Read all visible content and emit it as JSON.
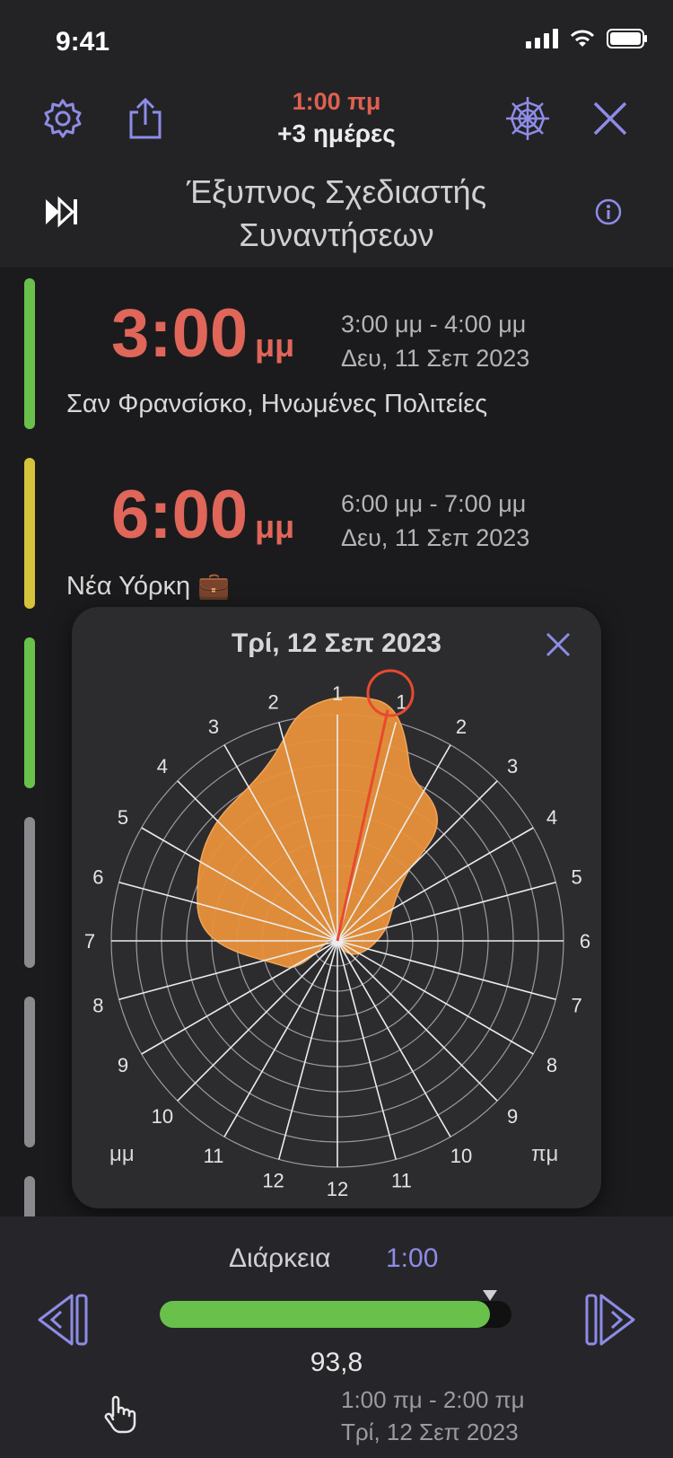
{
  "status": {
    "time": "9:41"
  },
  "header": {
    "time_label": "1:00 πμ",
    "offset_label": "+3 ημέρες",
    "title": "Έξυπνος Σχεδιαστής Συναντήσεων"
  },
  "events": [
    {
      "big_time": "3:00",
      "ampm": "μμ",
      "range": "3:00 μμ - 4:00 μμ",
      "date": "Δευ, 11 Σεπ 2023",
      "place": "Σαν Φρανσίσκο, Ηνωμένες Πολιτείες",
      "bar_color": "#69c14b"
    },
    {
      "big_time": "6:00",
      "ampm": "μμ",
      "range": "6:00 μμ - 7:00 μμ",
      "date": "Δευ, 11 Σεπ 2023",
      "place": "Νέα Υόρκη 💼",
      "bar_color": "#d7c23b"
    }
  ],
  "popup": {
    "title": "Τρί, 12 Σεπ 2023",
    "left_label": "μμ",
    "right_label": "πμ",
    "selected_hour": "1",
    "right_numbers": [
      "1",
      "2",
      "3",
      "4",
      "5",
      "6",
      "7",
      "8",
      "9",
      "10",
      "11",
      "12"
    ],
    "left_numbers": [
      "12",
      "11",
      "10",
      "9",
      "8",
      "7",
      "6",
      "5",
      "4",
      "3",
      "2",
      "1"
    ]
  },
  "footer": {
    "duration_label": "Διάρκεια",
    "duration_value": "1:00",
    "score": "93,8",
    "score_fraction": 0.938
  },
  "bottom_event": {
    "range": "1:00 πμ - 2:00 πμ",
    "date": "Τρί, 12 Σεπ 2023"
  }
}
